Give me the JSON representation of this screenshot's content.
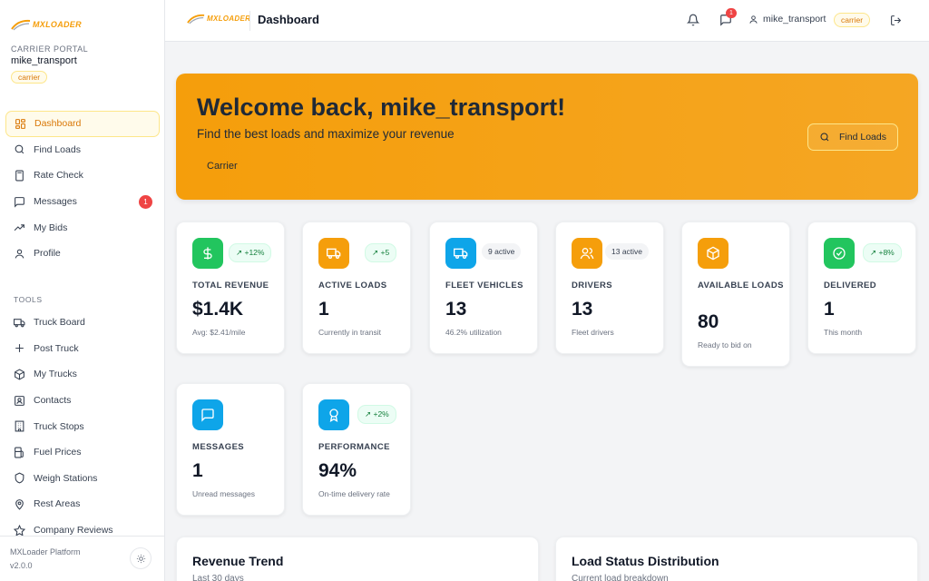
{
  "brand": {
    "logo_text": "MXLOADER",
    "accent": "#f59e0b"
  },
  "sidebar": {
    "portal_label": "CARRIER PORTAL",
    "user_name": "mike_transport",
    "role": "carrier",
    "nav": [
      {
        "label": "Dashboard",
        "icon": "dashboard-icon"
      },
      {
        "label": "Find Loads",
        "icon": "search-icon"
      },
      {
        "label": "Rate Check",
        "icon": "calculator-icon"
      },
      {
        "label": "Messages",
        "icon": "message-icon",
        "badge": "1"
      },
      {
        "label": "My Bids",
        "icon": "trending-up-icon"
      },
      {
        "label": "Profile",
        "icon": "user-icon"
      }
    ],
    "tools_title": "TOOLS",
    "tools": [
      {
        "label": "Truck Board",
        "icon": "truck-icon"
      },
      {
        "label": "Post Truck",
        "icon": "plus-icon"
      },
      {
        "label": "My Trucks",
        "icon": "box-icon"
      },
      {
        "label": "Contacts",
        "icon": "contact-icon"
      },
      {
        "label": "Truck Stops",
        "icon": "building-icon"
      },
      {
        "label": "Fuel Prices",
        "icon": "fuel-icon"
      },
      {
        "label": "Weigh Stations",
        "icon": "shield-icon"
      },
      {
        "label": "Rest Areas",
        "icon": "map-pin-icon"
      },
      {
        "label": "Company Reviews",
        "icon": "star-icon"
      }
    ],
    "footer": {
      "platform": "MXLoader Platform",
      "version": "v2.0.0"
    }
  },
  "topbar": {
    "title": "Dashboard",
    "message_badge": "1",
    "user": "mike_transport",
    "role": "carrier"
  },
  "hero": {
    "title": "Welcome back, mike_transport!",
    "subtitle": "Find the best loads and maximize your revenue",
    "role": "Carrier",
    "button": "Find Loads"
  },
  "cards": [
    {
      "label": "TOTAL REVENUE",
      "value": "$1.4K",
      "sub": "Avg: $2.41/mile",
      "badge": "+12%",
      "icon": "dollar-icon",
      "color": "#16a34a"
    },
    {
      "label": "ACTIVE LOADS",
      "value": "1",
      "sub": "Currently in transit",
      "badge": "+5",
      "icon": "truck-icon",
      "color": "#f59e0b"
    },
    {
      "label": "FLEET VEHICLES",
      "value": "13",
      "sub": "46.2% utilization",
      "badge": "9 active",
      "icon": "truck-icon",
      "color": "#0ea5e9"
    },
    {
      "label": "DRIVERS",
      "value": "13",
      "sub": "Fleet drivers",
      "badge": "13 active",
      "icon": "users-icon",
      "color": "#f59e0b"
    },
    {
      "label": "AVAILABLE LOADS",
      "value": "80",
      "sub": "Ready to bid on",
      "icon": "package-icon",
      "color": "#f59e0b"
    },
    {
      "label": "DELIVERED",
      "value": "1",
      "sub": "This month",
      "badge": "+8%",
      "icon": "check-circle-icon",
      "color": "#16a34a"
    },
    {
      "label": "MESSAGES",
      "value": "1",
      "sub": "Unread messages",
      "icon": "message-icon",
      "color": "#0ea5e9"
    },
    {
      "label": "PERFORMANCE",
      "value": "94%",
      "sub": "On-time delivery rate",
      "badge": "+2%",
      "icon": "award-icon",
      "color": "#0ea5e9"
    }
  ],
  "panels": [
    {
      "title": "Revenue Trend",
      "subtitle": "Last 30 days"
    },
    {
      "title": "Load Status Distribution",
      "subtitle": "Current load breakdown"
    }
  ]
}
